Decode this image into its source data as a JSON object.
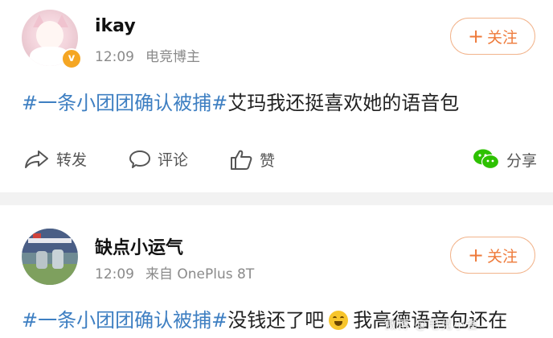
{
  "post1": {
    "username": "ikay",
    "time": "12:09",
    "source": "电竞博主",
    "verified_badge": "v",
    "follow_label": "关注",
    "follow_plus": "+",
    "hashtag": "#一条小团团确认被捕#",
    "text": "艾玛我还挺喜欢她的语音包",
    "actions": {
      "repost": "转发",
      "comment": "评论",
      "like": "赞",
      "share": "分享"
    }
  },
  "post2": {
    "username": "缺点小运气",
    "time": "12:09",
    "source": "来自 OnePlus 8T",
    "follow_label": "关注",
    "follow_plus": "+",
    "hashtag": "#一条小团团确认被捕#",
    "text_before_emoji": "没钱还了吧",
    "emoji": "laughing-crying-emoji",
    "text_after_emoji": "我高德语音包还在"
  },
  "watermark": "微博 @电竞小雀",
  "colors": {
    "link": "#3e7fc2",
    "follow": "#ee7a3a",
    "follow_border": "#f2b48c",
    "meta": "#8a8a8a",
    "divider": "#f2f2f2",
    "wechat": "#2dc100"
  }
}
